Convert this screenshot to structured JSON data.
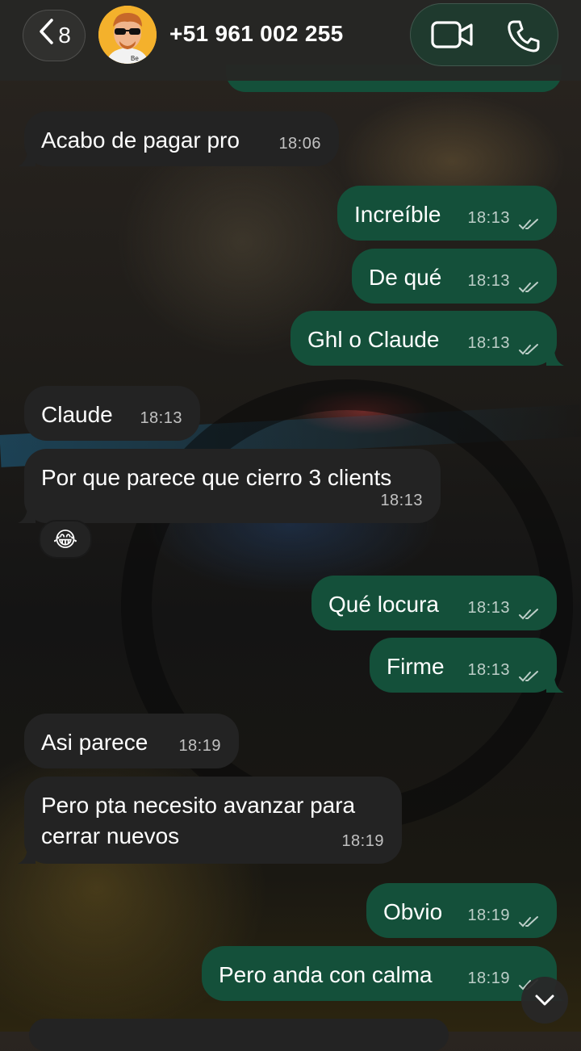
{
  "header": {
    "back_count": "8",
    "contact_name": "+51 961 002 255",
    "avatar_badge": "Be"
  },
  "messages": [
    {
      "dir": "in",
      "text": "Acabo de pagar pro",
      "time": "18:06"
    },
    {
      "dir": "out",
      "text": "Increíble",
      "time": "18:13"
    },
    {
      "dir": "out",
      "text": "De qué",
      "time": "18:13"
    },
    {
      "dir": "out",
      "text": "Ghl o Claude",
      "time": "18:13"
    },
    {
      "dir": "in",
      "text": "Claude",
      "time": "18:13"
    },
    {
      "dir": "in",
      "text": "Por que parece que cierro 3 clients",
      "time": "18:13",
      "reaction": "😂"
    },
    {
      "dir": "out",
      "text": "Qué locura",
      "time": "18:13"
    },
    {
      "dir": "out",
      "text": "Firme",
      "time": "18:13"
    },
    {
      "dir": "in",
      "text": "Asi parece",
      "time": "18:19"
    },
    {
      "dir": "in",
      "text_line1": "Pero pta necesito avanzar para",
      "text_line2": "cerrar nuevos",
      "time": "18:19"
    },
    {
      "dir": "out",
      "text": "Obvio",
      "time": "18:19"
    },
    {
      "dir": "out",
      "text": "Pero anda con calma",
      "time": "18:19"
    }
  ],
  "icons": {
    "back": "chevron-left-icon",
    "video": "video-camera-icon",
    "phone": "phone-icon",
    "read_receipt": "double-check-icon",
    "scroll_down": "chevron-down-icon"
  },
  "colors": {
    "incoming_bubble": "#232323",
    "outgoing_bubble": "#14503a",
    "header_bg": "#262624"
  }
}
